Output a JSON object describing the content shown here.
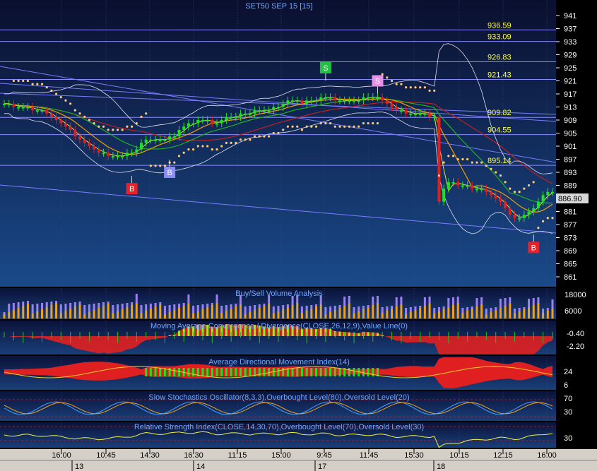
{
  "title": "SET50 SEP 15   [15]",
  "chart_data": [
    {
      "type": "candlestick",
      "title": "SET50 SEP 15   [15]",
      "ylim": [
        857,
        945
      ],
      "y_ticks": [
        941,
        937,
        933,
        929,
        925,
        921,
        917,
        913,
        909,
        905,
        901,
        897,
        893,
        889,
        885,
        881,
        877,
        873,
        869,
        865,
        861
      ],
      "last_price": "886.90",
      "level_lines": [
        {
          "value": 936.59,
          "label": "936.59"
        },
        {
          "value": 933.09,
          "label": "933.09"
        },
        {
          "value": 926.83,
          "label": "926.83"
        },
        {
          "value": 921.43,
          "label": "921.43"
        },
        {
          "value": 909.82,
          "label": "909.82"
        },
        {
          "value": 904.55,
          "label": "904.55"
        },
        {
          "value": 895.14,
          "label": "895.14"
        }
      ],
      "signals": [
        {
          "label": "B",
          "bar": 27,
          "value": 888,
          "color": "#e8202a"
        },
        {
          "label": "B",
          "bar": 35,
          "value": 893,
          "color": "#8a8ff0"
        },
        {
          "label": "S",
          "bar": 68,
          "value": 925,
          "color": "#20c040"
        },
        {
          "label": "S",
          "bar": 79,
          "value": 921,
          "color": "#e890e8"
        },
        {
          "label": "B",
          "bar": 112,
          "value": 870,
          "color": "#e8202a"
        }
      ],
      "close": [
        914,
        914,
        913,
        913,
        913,
        913,
        912,
        912,
        912,
        911,
        910,
        909,
        908,
        907,
        906,
        904,
        903,
        902,
        901,
        900,
        899,
        899,
        898,
        898,
        898,
        898,
        899,
        899,
        900,
        902,
        903,
        903,
        903,
        903,
        903,
        904,
        904,
        906,
        907,
        908,
        908,
        909,
        909,
        909,
        908,
        908,
        909,
        910,
        910,
        910,
        911,
        911,
        911,
        912,
        912,
        912,
        912,
        913,
        913,
        914,
        915,
        915,
        915,
        914,
        915,
        915,
        915,
        916,
        916,
        916,
        915,
        915,
        915,
        915,
        915,
        915,
        916,
        916,
        916,
        916,
        915,
        914,
        913,
        912,
        912,
        911,
        911,
        911,
        911,
        911,
        910,
        910,
        884,
        888,
        890,
        890,
        889,
        889,
        889,
        888,
        888,
        888,
        887,
        886,
        885,
        884,
        882,
        880,
        879,
        879,
        880,
        881,
        882,
        884,
        886,
        887,
        887
      ]
    },
    {
      "type": "bar",
      "title": "Buy/Sell Volume Analysis",
      "y_ticks": [
        18000,
        6000
      ]
    },
    {
      "type": "area",
      "title": "Moving Average Convergence / Divergence(CLOSE,26,12,9),Value Line(0)",
      "y_ticks": [
        -0.4,
        -2.2
      ],
      "y_tick_labels": [
        "-0.40",
        "-2.20"
      ]
    },
    {
      "type": "area",
      "title": "Average Directional Movement Index(14)",
      "y_ticks": [
        24,
        6
      ]
    },
    {
      "type": "line",
      "title": "Slow Stochastics Oscillator(8,3,3),Overbought Level(80),Oversold Level(20)",
      "y_ticks": [
        70,
        30
      ]
    },
    {
      "type": "line",
      "title": "Relative Strength Index(CLOSE,14,30,70),Overbought Level(70),Oversold Level(30)",
      "y_ticks": [
        30
      ]
    }
  ],
  "x_axis": {
    "time_labels": [
      "16:00",
      "10:45",
      "14:30",
      "16:30",
      "11:15",
      "15:00",
      "9:45",
      "11:45",
      "15:30",
      "10:15",
      "12:15",
      "16:00"
    ],
    "day_labels": [
      "13",
      "14",
      "17",
      "18"
    ]
  }
}
